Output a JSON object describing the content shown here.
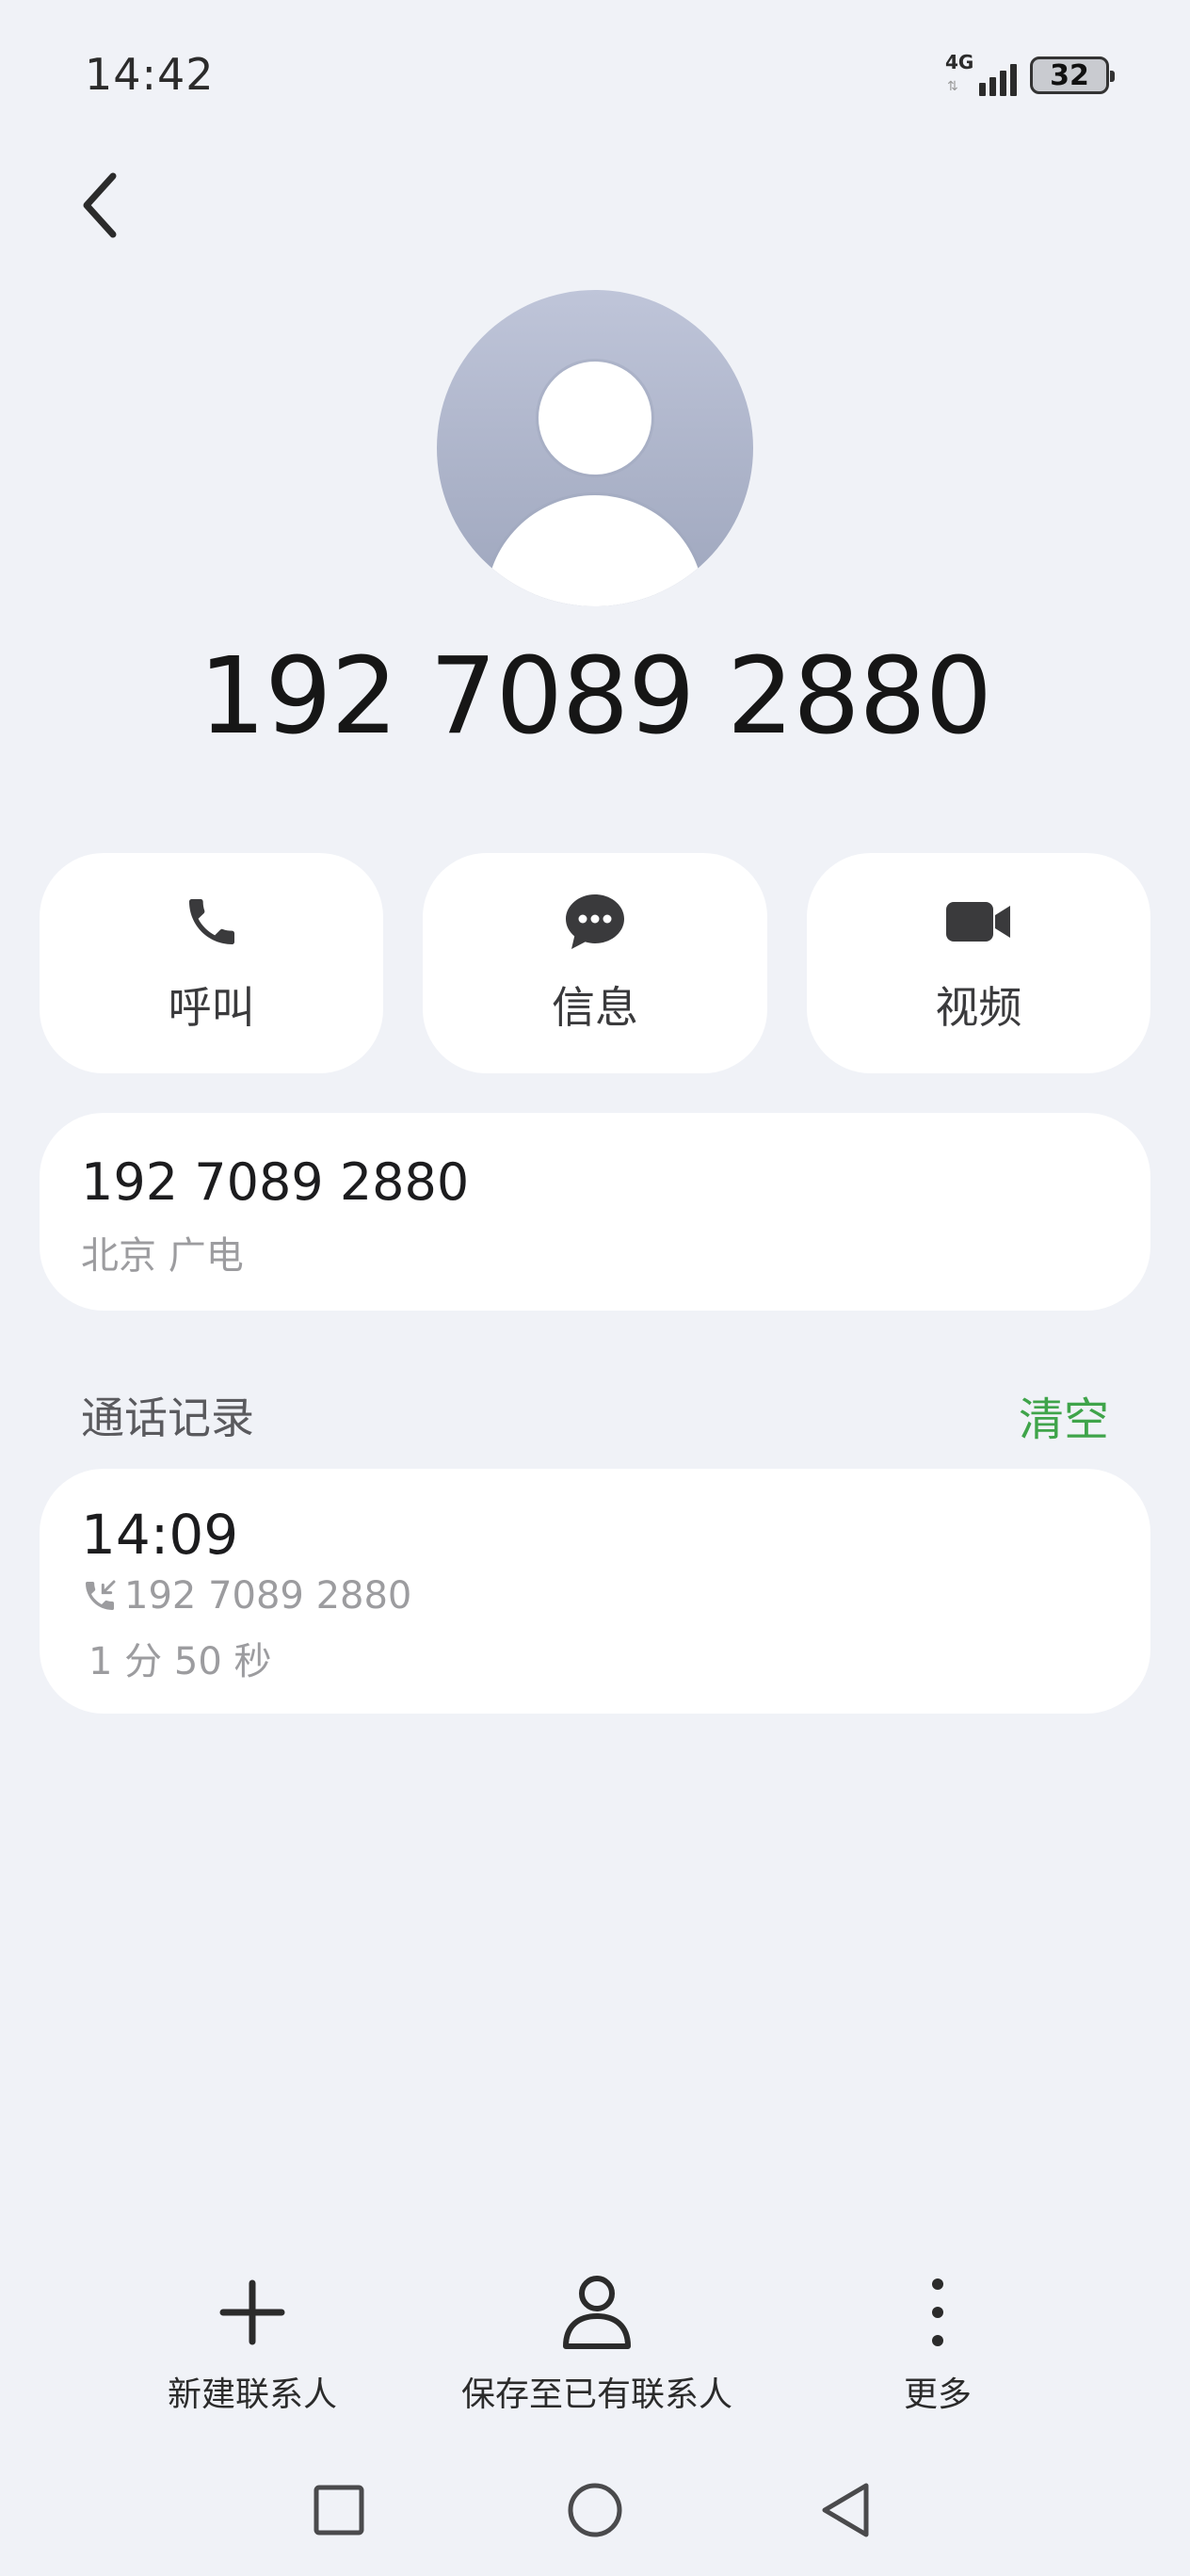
{
  "status_bar": {
    "time": "14:42",
    "network": "4G",
    "battery": "32"
  },
  "contact": {
    "number_display": "192 7089 2880"
  },
  "actions": [
    {
      "label": "呼叫",
      "icon": "phone-icon"
    },
    {
      "label": "信息",
      "icon": "message-icon"
    },
    {
      "label": "视频",
      "icon": "video-icon"
    }
  ],
  "number_card": {
    "number": "192 7089 2880",
    "location": "北京 广电"
  },
  "call_log": {
    "title": "通话记录",
    "clear_label": "清空",
    "entries": [
      {
        "time": "14:09",
        "number": "192 7089 2880",
        "duration": "1 分 50 秒",
        "icon": "incoming-call-icon"
      }
    ]
  },
  "bottom_actions": [
    {
      "label": "新建联系人",
      "icon": "plus-icon"
    },
    {
      "label": "保存至已有联系人",
      "icon": "person-icon"
    },
    {
      "label": "更多",
      "icon": "more-vertical-icon"
    }
  ],
  "navbar": [
    "recent-apps-icon",
    "home-icon",
    "back-triangle-icon"
  ],
  "colors": {
    "accent_green": "#3fa44a",
    "background": "#f0f2f7",
    "card": "#ffffff"
  }
}
